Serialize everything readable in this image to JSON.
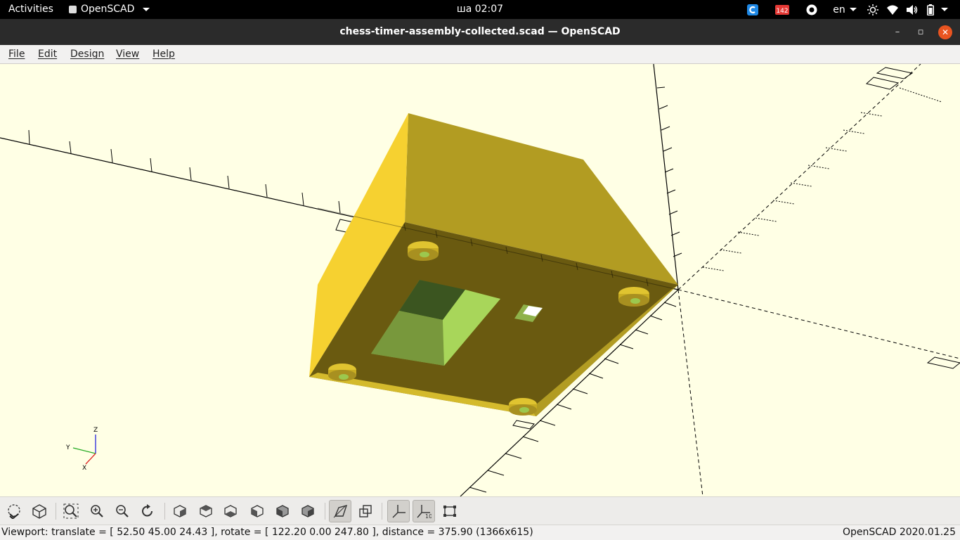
{
  "topbar": {
    "activities": "Activities",
    "app_name": "OpenSCAD",
    "clock": "ша 02:07",
    "tray": {
      "notification_count": "142",
      "language": "en"
    }
  },
  "window": {
    "title": "chess-timer-assembly-collected.scad — OpenSCAD",
    "controls": {
      "minimize": "–",
      "maximize": "▫",
      "close": "✕"
    }
  },
  "menu": {
    "file": "File",
    "edit": "Edit",
    "design": "Design",
    "view": "View",
    "help": "Help"
  },
  "viewport": {
    "axes_labels": {
      "x": "X",
      "y": "Y",
      "z": "Z"
    },
    "model_color": "#f8d83e",
    "background_color": "#ffffe5"
  },
  "toolbar": {
    "buttons": [
      "preview-icon",
      "render-icon",
      "view-all-icon",
      "zoom-in-icon",
      "zoom-out-icon",
      "reset-view-icon",
      "view-right-icon",
      "view-top-icon",
      "view-bottom-icon",
      "view-left-icon",
      "view-front-icon",
      "view-back-icon",
      "perspective-icon",
      "orthogonal-icon",
      "show-axes-icon",
      "show-scale-markers-icon",
      "show-edges-icon"
    ],
    "active": [
      "perspective-icon",
      "show-axes-icon",
      "show-scale-markers-icon"
    ]
  },
  "status": {
    "viewport_info": "Viewport: translate = [ 52.50 45.00 24.43 ], rotate = [ 122.20 0.00 247.80 ], distance = 375.90 (1366x615)",
    "version": "OpenSCAD 2020.01.25"
  }
}
